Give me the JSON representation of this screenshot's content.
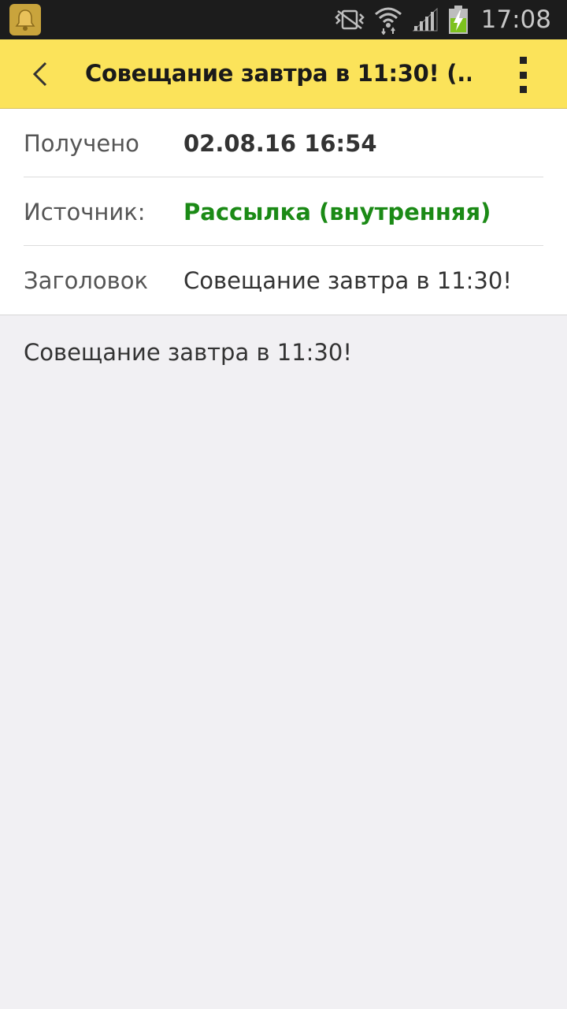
{
  "status_bar": {
    "time": "17:08",
    "icons": [
      "app-notification-icon",
      "vibrate-icon",
      "wifi-icon",
      "signal-icon",
      "battery-charging-icon"
    ]
  },
  "app_bar": {
    "title": "Совещание завтра в 11:30! (...",
    "back_icon": "chevron-left-icon",
    "menu_icon": "more-vertical-icon",
    "background_color": "#fbe35a"
  },
  "details": [
    {
      "label": "Получено",
      "value": "02.08.16 16:54"
    },
    {
      "label": "Источник:",
      "value": "Рассылка (внутренняя)",
      "value_color": "#1b8a16"
    },
    {
      "label": "Заголовок",
      "value": "Совещание завтра в 11:30!"
    }
  ],
  "message": {
    "body": "Совещание завтра в 11:30!"
  }
}
